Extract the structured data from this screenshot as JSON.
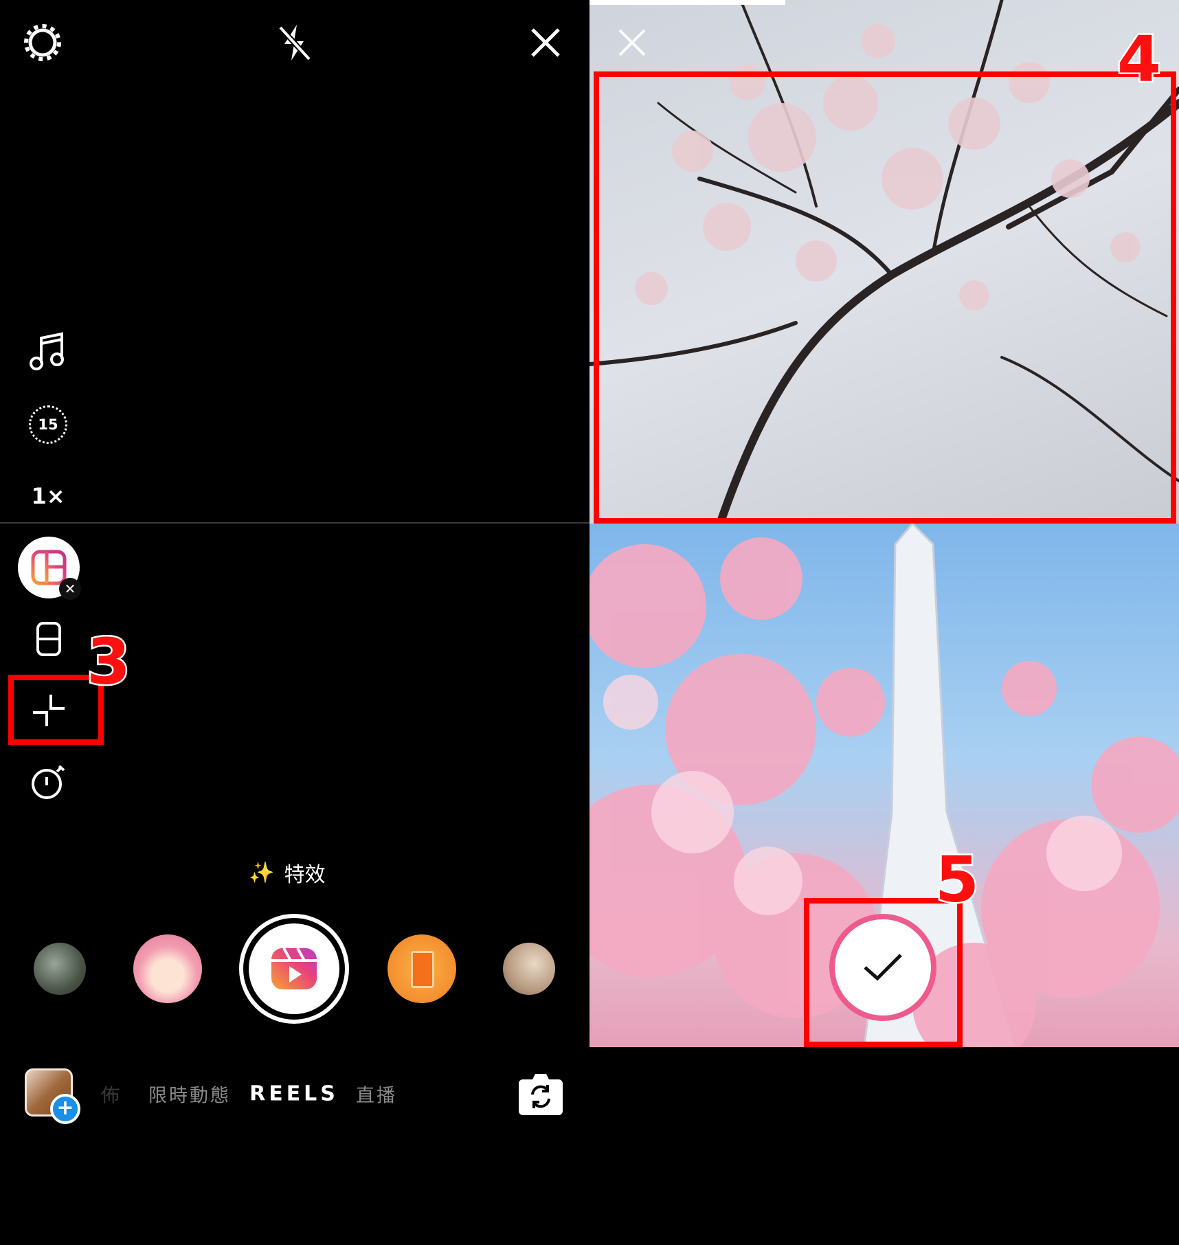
{
  "camera": {
    "top_icons": [
      "gear-icon",
      "flash-off-icon",
      "close-icon"
    ],
    "side_tools": {
      "timer_length": "15",
      "zoom": "1×"
    },
    "effects_label": "特效",
    "modes": [
      {
        "label": "佈",
        "active": false
      },
      {
        "label": "限時動態",
        "active": false
      },
      {
        "label": "REELS",
        "active": true
      },
      {
        "label": "直播",
        "active": false
      }
    ]
  },
  "annotations": {
    "step3": "3",
    "step4": "4",
    "step5": "5",
    "color": "#ff0000"
  },
  "preview": {
    "confirm_icon": "checkmark-icon",
    "ring_color": "#ee5a8c"
  },
  "colors": {
    "accent_blue": "#1a8fe8",
    "orange": "#f58a2a"
  }
}
